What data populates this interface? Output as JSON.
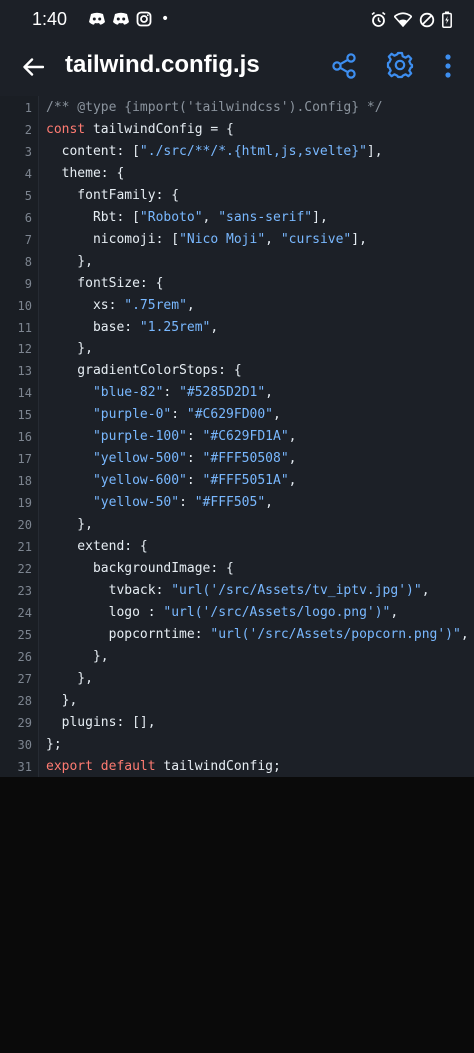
{
  "status_bar": {
    "time": "1:40",
    "dot": "•",
    "left_icons": [
      "discord-icon",
      "discord-icon",
      "instagram-icon"
    ],
    "right_icons": [
      "alarm-icon",
      "wifi-icon",
      "do-not-disturb-icon",
      "battery-icon"
    ]
  },
  "app_bar": {
    "title": "tailwind.config.js",
    "back_icon": "arrow-left-icon",
    "share_icon": "share-icon",
    "settings_icon": "gear-icon",
    "more_icon": "more-vertical-icon"
  },
  "colors": {
    "accent": "#3d8ef0",
    "keyword": "#ff7b72",
    "string": "#79b8ff",
    "comment": "#8b949e",
    "editor_bg": "#1c2027"
  },
  "editor": {
    "lines": [
      {
        "n": "1",
        "tokens": [
          [
            "comment",
            "/** @type {import('tailwindcss').Config} */"
          ]
        ]
      },
      {
        "n": "2",
        "tokens": [
          [
            "keyword",
            "const"
          ],
          [
            "plain",
            " tailwindConfig = {"
          ]
        ]
      },
      {
        "n": "3",
        "tokens": [
          [
            "plain",
            "  content: ["
          ],
          [
            "string",
            "\"./src/**/*.{html,js,svelte}\""
          ],
          [
            "plain",
            "],"
          ]
        ]
      },
      {
        "n": "4",
        "tokens": [
          [
            "plain",
            "  theme: {"
          ]
        ]
      },
      {
        "n": "5",
        "tokens": [
          [
            "plain",
            "    fontFamily: {"
          ]
        ]
      },
      {
        "n": "6",
        "tokens": [
          [
            "plain",
            "      Rbt: ["
          ],
          [
            "string",
            "\"Roboto\""
          ],
          [
            "plain",
            ", "
          ],
          [
            "string",
            "\"sans-serif\""
          ],
          [
            "plain",
            "],"
          ]
        ]
      },
      {
        "n": "7",
        "tokens": [
          [
            "plain",
            "      nicomoji: ["
          ],
          [
            "string",
            "\"Nico Moji\""
          ],
          [
            "plain",
            ", "
          ],
          [
            "string",
            "\"cursive\""
          ],
          [
            "plain",
            "],"
          ]
        ]
      },
      {
        "n": "8",
        "tokens": [
          [
            "plain",
            "    },"
          ]
        ]
      },
      {
        "n": "9",
        "tokens": [
          [
            "plain",
            "    fontSize: {"
          ]
        ]
      },
      {
        "n": "10",
        "tokens": [
          [
            "plain",
            "      xs: "
          ],
          [
            "string",
            "\".75rem\""
          ],
          [
            "plain",
            ","
          ]
        ]
      },
      {
        "n": "11",
        "tokens": [
          [
            "plain",
            "      base: "
          ],
          [
            "string",
            "\"1.25rem\""
          ],
          [
            "plain",
            ","
          ]
        ]
      },
      {
        "n": "12",
        "tokens": [
          [
            "plain",
            "    },"
          ]
        ]
      },
      {
        "n": "13",
        "tokens": [
          [
            "plain",
            "    gradientColorStops: {"
          ]
        ]
      },
      {
        "n": "14",
        "tokens": [
          [
            "plain",
            "      "
          ],
          [
            "string",
            "\"blue-82\""
          ],
          [
            "plain",
            ": "
          ],
          [
            "string",
            "\"#5285D2D1\""
          ],
          [
            "plain",
            ","
          ]
        ]
      },
      {
        "n": "15",
        "tokens": [
          [
            "plain",
            "      "
          ],
          [
            "string",
            "\"purple-0\""
          ],
          [
            "plain",
            ": "
          ],
          [
            "string",
            "\"#C629FD00\""
          ],
          [
            "plain",
            ","
          ]
        ]
      },
      {
        "n": "16",
        "tokens": [
          [
            "plain",
            "      "
          ],
          [
            "string",
            "\"purple-100\""
          ],
          [
            "plain",
            ": "
          ],
          [
            "string",
            "\"#C629FD1A\""
          ],
          [
            "plain",
            ","
          ]
        ]
      },
      {
        "n": "17",
        "tokens": [
          [
            "plain",
            "      "
          ],
          [
            "string",
            "\"yellow-500\""
          ],
          [
            "plain",
            ": "
          ],
          [
            "string",
            "\"#FFF50508\""
          ],
          [
            "plain",
            ","
          ]
        ]
      },
      {
        "n": "18",
        "tokens": [
          [
            "plain",
            "      "
          ],
          [
            "string",
            "\"yellow-600\""
          ],
          [
            "plain",
            ": "
          ],
          [
            "string",
            "\"#FFF5051A\""
          ],
          [
            "plain",
            ","
          ]
        ]
      },
      {
        "n": "19",
        "tokens": [
          [
            "plain",
            "      "
          ],
          [
            "string",
            "\"yellow-50\""
          ],
          [
            "plain",
            ": "
          ],
          [
            "string",
            "\"#FFF505\""
          ],
          [
            "plain",
            ","
          ]
        ]
      },
      {
        "n": "20",
        "tokens": [
          [
            "plain",
            "    },"
          ]
        ]
      },
      {
        "n": "21",
        "tokens": [
          [
            "plain",
            "    extend: {"
          ]
        ]
      },
      {
        "n": "22",
        "tokens": [
          [
            "plain",
            "      backgroundImage: {"
          ]
        ]
      },
      {
        "n": "23",
        "tokens": [
          [
            "plain",
            "        tvback: "
          ],
          [
            "string",
            "\"url('/src/Assets/tv_iptv.jpg')\""
          ],
          [
            "plain",
            ","
          ]
        ]
      },
      {
        "n": "24",
        "tokens": [
          [
            "plain",
            "        logo : "
          ],
          [
            "string",
            "\"url('/src/Assets/logo.png')\""
          ],
          [
            "plain",
            ","
          ]
        ]
      },
      {
        "n": "25",
        "tokens": [
          [
            "plain",
            "        popcorntime: "
          ],
          [
            "string",
            "\"url('/src/Assets/popcorn.png')\""
          ],
          [
            "plain",
            ","
          ]
        ]
      },
      {
        "n": "26",
        "tokens": [
          [
            "plain",
            "      },"
          ]
        ]
      },
      {
        "n": "27",
        "tokens": [
          [
            "plain",
            "    },"
          ]
        ]
      },
      {
        "n": "28",
        "tokens": [
          [
            "plain",
            "  },"
          ]
        ]
      },
      {
        "n": "29",
        "tokens": [
          [
            "plain",
            "  plugins: [],"
          ]
        ]
      },
      {
        "n": "30",
        "tokens": [
          [
            "plain",
            "};"
          ]
        ]
      },
      {
        "n": "31",
        "tokens": [
          [
            "keyword",
            "export"
          ],
          [
            "plain",
            " "
          ],
          [
            "keyword",
            "default"
          ],
          [
            "plain",
            " tailwindConfig;"
          ]
        ]
      }
    ]
  }
}
